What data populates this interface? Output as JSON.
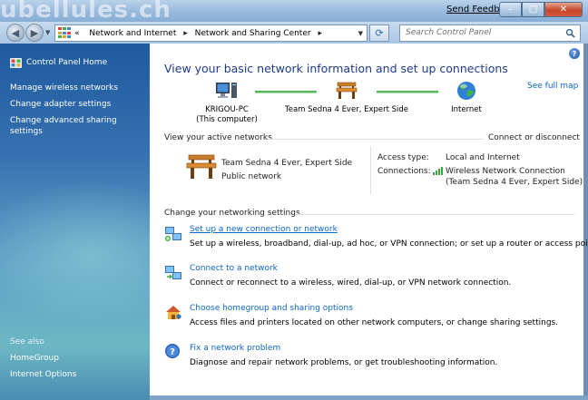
{
  "window": {
    "watermark": "ubellules.ch",
    "send_feedback": "Send Feedback",
    "buttons": {
      "minimize": "–",
      "maximize": "□",
      "close": "✕"
    }
  },
  "nav": {
    "breadcrumb_prefix": "«",
    "breadcrumb": [
      "Network and Internet",
      "Network and Sharing Center"
    ],
    "breadcrumb_sep": "▸",
    "search_placeholder": "Search Control Panel"
  },
  "sidebar": {
    "home": "Control Panel Home",
    "items": [
      {
        "label": "Manage wireless networks"
      },
      {
        "label": "Change adapter settings"
      },
      {
        "label": "Change advanced sharing"
      },
      {
        "label": "settings"
      }
    ],
    "see_also_title": "See also",
    "see_also": [
      {
        "label": "HomeGroup"
      },
      {
        "label": "Internet Options"
      }
    ]
  },
  "main": {
    "help": "?",
    "title": "View your basic network information and set up connections",
    "see_full_map": "See full map",
    "map": {
      "computer_name": "KRIGOU-PC",
      "computer_sub": "(This computer)",
      "network_name": "Team Sedna 4 Ever, Expert Side",
      "internet": "Internet"
    },
    "active_networks_label": "View your active networks",
    "connect_or_disconnect": "Connect or disconnect",
    "active": {
      "name": "Team Sedna 4 Ever, Expert Side",
      "category": "Public network",
      "access_type_label": "Access type:",
      "access_type_value": "Local and Internet",
      "connections_label": "Connections:",
      "connection_line1": "Wireless Network Connection",
      "connection_line2": "(Team Sedna 4 Ever, Expert Side)"
    },
    "change_settings_label": "Change your networking settings",
    "tasks": [
      {
        "title": "Set up a new connection or network",
        "description": "Set up a wireless, broadband, dial-up, ad hoc, or VPN connection; or set up a router or access point.",
        "icon": "new-connection-icon"
      },
      {
        "title": "Connect to a network",
        "description": "Connect or reconnect to a wireless, wired, dial-up, or VPN network connection.",
        "icon": "connect-network-icon"
      },
      {
        "title": "Choose homegroup and sharing options",
        "description": "Access files and printers located on other network computers, or change sharing settings.",
        "icon": "homegroup-icon"
      },
      {
        "title": "Fix a network problem",
        "description": "Diagnose and repair network problems, or get troubleshooting information.",
        "icon": "troubleshoot-icon"
      }
    ]
  },
  "colors": {
    "link": "#0b66c9",
    "title_blue": "#1e3a8a",
    "map_line": "#55b95c",
    "sidebar_top": "#1f5a9e",
    "sidebar_bottom": "#6cb7c4"
  }
}
